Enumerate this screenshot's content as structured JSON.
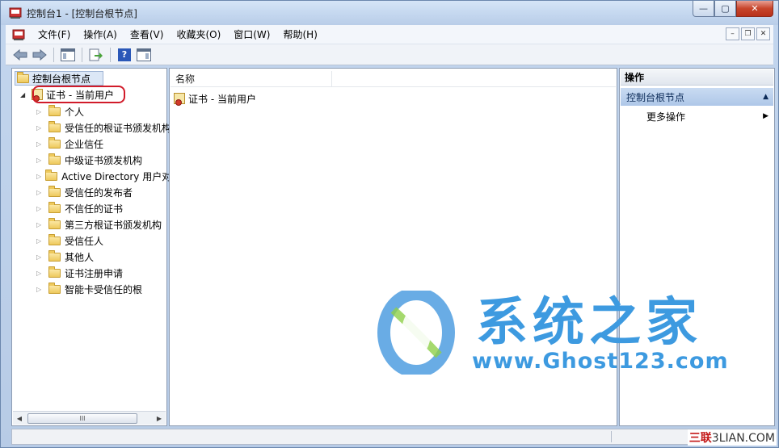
{
  "window": {
    "title": "控制台1 - [控制台根节点]",
    "controls": {
      "minimize": "—",
      "maximize": "▢",
      "close": "✕"
    }
  },
  "menu": {
    "items": [
      "文件(F)",
      "操作(A)",
      "查看(V)",
      "收藏夹(O)",
      "窗口(W)",
      "帮助(H)"
    ],
    "mdi": {
      "minimize": "–",
      "restore": "❐",
      "close": "✕"
    }
  },
  "toolbar": {
    "icons": [
      "back-arrow-icon",
      "forward-arrow-icon",
      "show-hide-tree-icon",
      "export-list-icon",
      "help-icon",
      "show-hide-action-icon"
    ],
    "help_label": "?"
  },
  "tree": {
    "root": "控制台根节点",
    "current_node": "证书 - 当前用户",
    "children": [
      "个人",
      "受信任的根证书颁发机构",
      "企业信任",
      "中级证书颁发机构",
      "Active Directory 用户对象",
      "受信任的发布者",
      "不信任的证书",
      "第三方根证书颁发机构",
      "受信任人",
      "其他人",
      "证书注册申请",
      "智能卡受信任的根"
    ],
    "scroll_thumb_label": "III"
  },
  "list": {
    "column_name": "名称",
    "rows": [
      "证书 - 当前用户"
    ]
  },
  "actions": {
    "header": "操作",
    "section": "控制台根节点",
    "more": "更多操作"
  },
  "watermark": {
    "title": "系统之家",
    "url": "www.Ghost123.com",
    "corner_red": "三联",
    "corner_rest": "3LIAN.COM"
  },
  "colors": {
    "highlight_ring": "#d11b2a",
    "watermark": "#3d9ae0",
    "action_section": "#aec7e8"
  }
}
